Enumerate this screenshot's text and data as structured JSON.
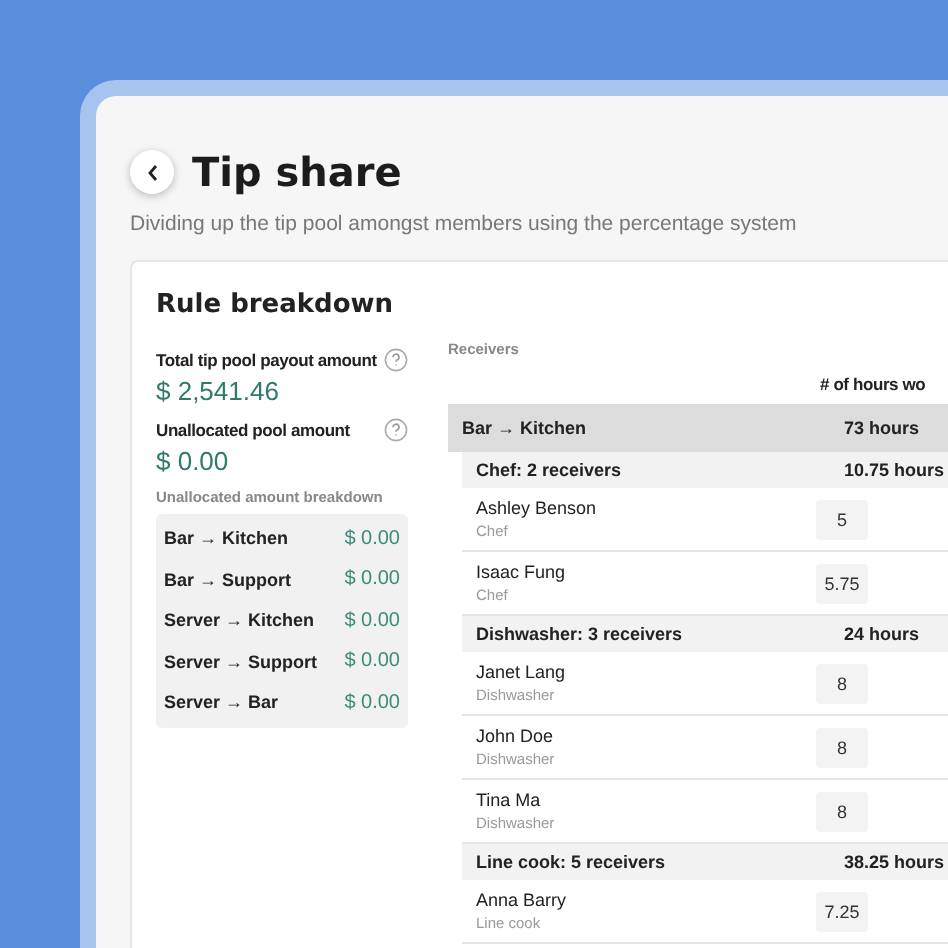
{
  "page": {
    "title": "Tip share",
    "subtitle": "Dividing up the tip pool amongst members using the percentage system"
  },
  "card": {
    "title": "Rule breakdown",
    "summary": [
      {
        "label": "Total tip pool payout amount",
        "value": "$ 2,541.46"
      },
      {
        "label": "Unallocated pool amount",
        "value": "$ 0.00"
      }
    ],
    "breakdown": {
      "label": "Unallocated amount breakdown",
      "rows": [
        {
          "rule": "Bar → Kitchen",
          "amount": "$ 0.00"
        },
        {
          "rule": "Bar → Support",
          "amount": "$ 0.00"
        },
        {
          "rule": "Server → Kitchen",
          "amount": "$ 0.00"
        },
        {
          "rule": "Server → Support",
          "amount": "$ 0.00"
        },
        {
          "rule": "Server → Bar",
          "amount": "$ 0.00"
        }
      ]
    },
    "receivers": {
      "label": "Receivers",
      "column_header": "# of hours wo",
      "groups": [
        {
          "label": "Bar → Kitchen",
          "hours": "73 hours",
          "roles": [
            {
              "label": "Chef: 2 receivers",
              "hours": "10.75 hours",
              "people": [
                {
                  "name": "Ashley Benson",
                  "role": "Chef",
                  "hours": "5"
                },
                {
                  "name": "Isaac Fung",
                  "role": "Chef",
                  "hours": "5.75"
                }
              ]
            },
            {
              "label": "Dishwasher: 3 receivers",
              "hours": "24 hours",
              "people": [
                {
                  "name": "Janet Lang",
                  "role": "Dishwasher",
                  "hours": "8"
                },
                {
                  "name": "John Doe",
                  "role": "Dishwasher",
                  "hours": "8"
                },
                {
                  "name": "Tina Ma",
                  "role": "Dishwasher",
                  "hours": "8"
                }
              ]
            },
            {
              "label": "Line cook: 5 receivers",
              "hours": "38.25 hours",
              "people": [
                {
                  "name": "Anna Barry",
                  "role": "Line cook",
                  "hours": "7.25"
                }
              ]
            }
          ]
        }
      ]
    }
  }
}
